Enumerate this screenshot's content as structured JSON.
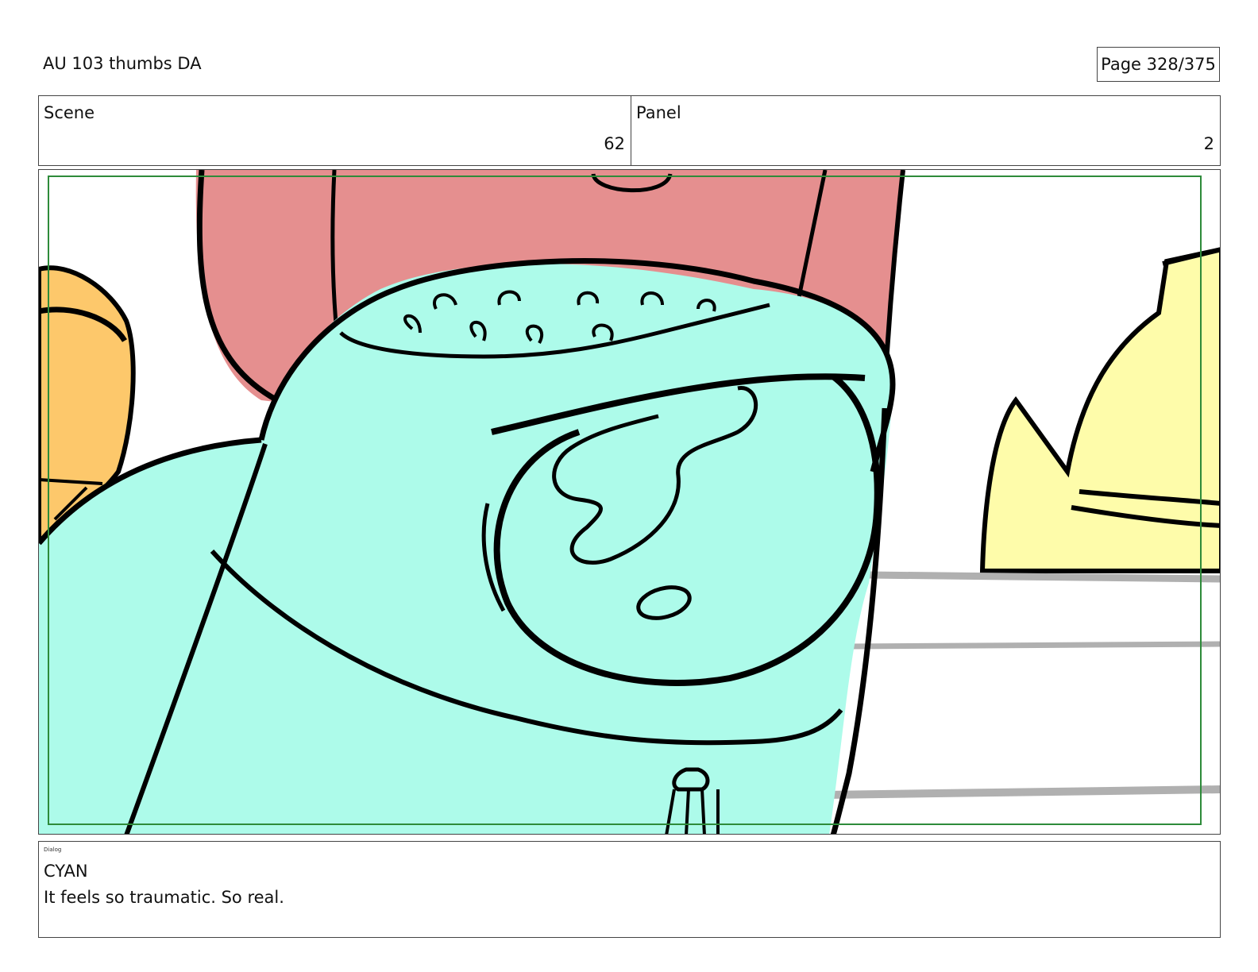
{
  "header": {
    "title": "AU 103 thumbs DA",
    "page": "Page 328/375"
  },
  "info": {
    "scene_label": "Scene",
    "scene_value": "62",
    "panel_label": "Panel",
    "panel_value": "2"
  },
  "panel_image": {
    "colors": {
      "cyan": "#adfbea",
      "pink": "#e58f8f",
      "orange": "#fdc86b",
      "yellow": "#fefcaa",
      "outline": "#000000",
      "safe_frame": "#2e8b3a",
      "table_line": "#b0b0b0"
    }
  },
  "dialog": {
    "label": "Dialog",
    "character": "CYAN",
    "line": "It feels so traumatic. So real."
  }
}
